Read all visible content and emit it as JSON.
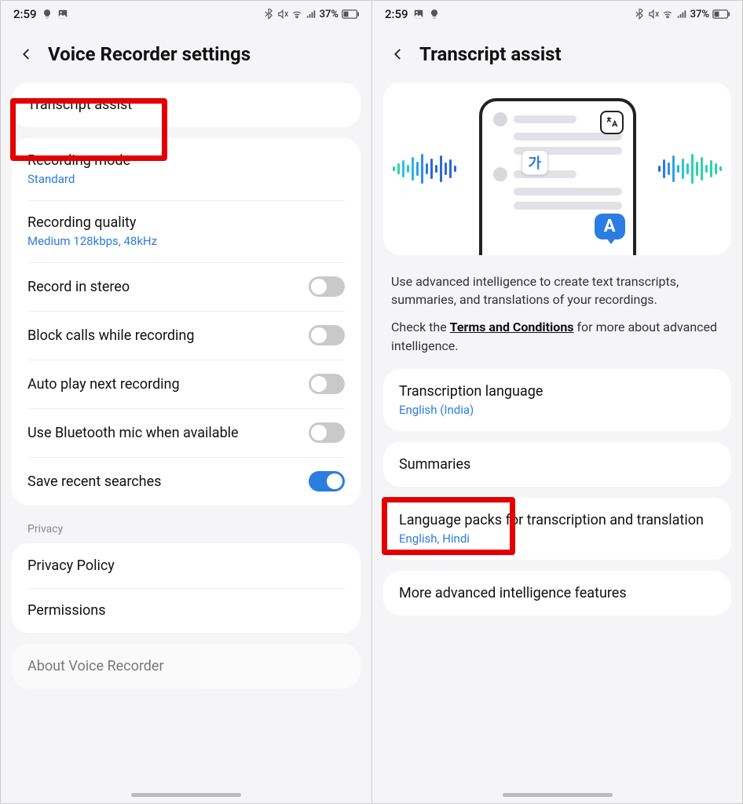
{
  "status": {
    "time": "2:59",
    "battery": "37%"
  },
  "left": {
    "title": "Voice Recorder settings",
    "transcript_assist": "Transcript assist",
    "rec_mode": {
      "label": "Recording mode",
      "sub": "Standard"
    },
    "rec_quality": {
      "label": "Recording quality",
      "sub": "Medium 128kbps, 48kHz"
    },
    "stereo": "Record in stereo",
    "block_calls": "Block calls while recording",
    "autoplay": "Auto play next recording",
    "bt_mic": "Use Bluetooth mic when available",
    "save_search": "Save recent searches",
    "privacy_section": "Privacy",
    "privacy_policy": "Privacy Policy",
    "permissions": "Permissions",
    "about": "About Voice Recorder"
  },
  "right": {
    "title": "Transcript assist",
    "desc1": "Use advanced intelligence to create text transcripts, summaries, and translations of your recordings.",
    "desc2a": "Check the ",
    "desc2link": "Terms and Conditions",
    "desc2b": " for more about advanced intelligence.",
    "lang": {
      "label": "Transcription language",
      "sub": "English (India)"
    },
    "summaries": "Summaries",
    "packs": {
      "label": "Language packs for transcription and translation",
      "sub": "English, Hindi"
    },
    "more": "More advanced intelligence features",
    "illus": {
      "ko": "가",
      "a": "A"
    }
  }
}
